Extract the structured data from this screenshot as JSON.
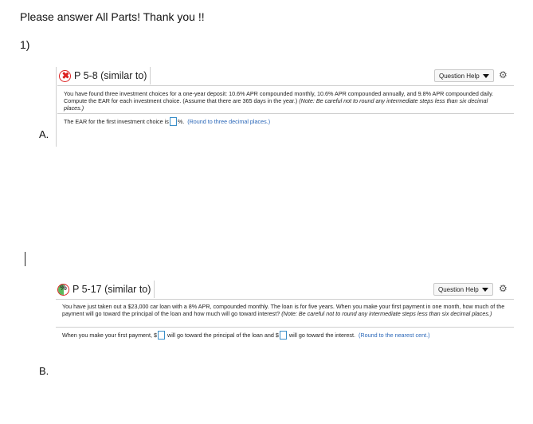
{
  "doc": {
    "title": "Please answer All Parts! Thank you !!",
    "question_number": "1)",
    "part_a": "A.",
    "part_b": "B."
  },
  "problems": [
    {
      "status": "incorrect",
      "title": "P 5-8 (similar to)",
      "help_label": "Question Help",
      "body": "You have found three investment choices for a one-year deposit: 10.6% APR compounded monthly, 10.6% APR compounded annually, and 9.8% APR compounded daily. Compute the EAR for each investment choice. (Assume that there are 365 days in the year.) ",
      "note": "(Note: Be careful not to round any intermediate steps less than six decimal places.)",
      "answer_prefix": "The EAR for the first investment choice is",
      "answer_suffix": "%.",
      "hint": "(Round to three decimal places.)"
    },
    {
      "status": "partial",
      "title": "P 5-17 (similar to)",
      "help_label": "Question Help",
      "body": "You have just taken out a $23,000 car loan with a 8% APR, compounded monthly. The loan is for five years. When you make your first payment in one month, how much of the payment will go toward the principal of the loan and how much will go toward interest? ",
      "note": "(Note: Be careful not to round any intermediate steps less than six decimal places.)",
      "answer_prefix": "When you make your first payment, $",
      "answer_middle": "will go toward the principal of the loan and $",
      "answer_suffix": "will go toward the interest.",
      "hint": "(Round to the nearest cent.)"
    }
  ],
  "colors": {
    "incorrect": "#dd2222",
    "partial_green": "#5cb85c",
    "hint_blue": "#2a67b8",
    "input_border": "#3a8fc9"
  },
  "icons": {
    "status_incorrect": "x-circle-icon",
    "status_partial": "partial-credit-icon",
    "settings": "gear-icon",
    "dropdown": "caret-down-icon"
  }
}
